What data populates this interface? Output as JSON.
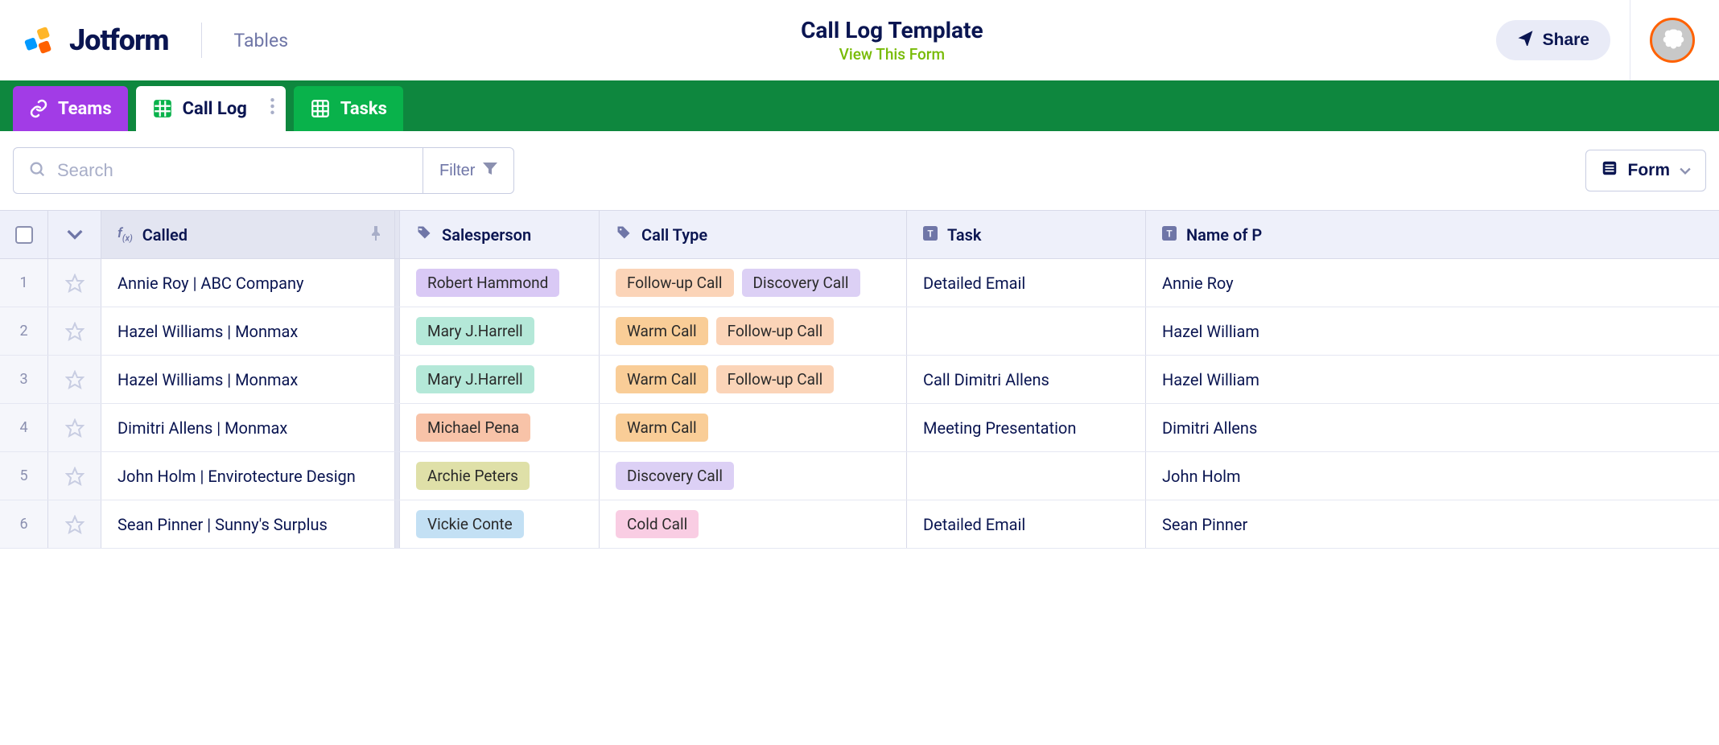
{
  "header": {
    "brand": "Jotform",
    "section": "Tables",
    "title": "Call Log Template",
    "view_form": "View This Form",
    "share": "Share"
  },
  "tabs": {
    "teams": "Teams",
    "call_log": "Call Log",
    "tasks": "Tasks"
  },
  "toolbar": {
    "search_placeholder": "Search",
    "filter": "Filter",
    "form": "Form"
  },
  "columns": {
    "called": "Called",
    "salesperson": "Salesperson",
    "call_type": "Call Type",
    "task": "Task",
    "name_of": "Name of P"
  },
  "tag_colors": {
    "Robert Hammond": "tag-purple",
    "Mary J.Harrell": "tag-teal",
    "Michael Pena": "tag-salmon",
    "Archie Peters": "tag-olive",
    "Vickie Conte": "tag-blue",
    "Follow-up Call": "tag-peach",
    "Discovery Call": "tag-lav",
    "Warm Call": "tag-orange",
    "Cold Call": "tag-pink"
  },
  "rows": [
    {
      "num": "1",
      "called": "Annie Roy | ABC Company",
      "salesperson": [
        "Robert Hammond"
      ],
      "call_type": [
        "Follow-up Call",
        "Discovery Call"
      ],
      "task": "Detailed Email",
      "name": "Annie Roy"
    },
    {
      "num": "2",
      "called": "Hazel Williams | Monmax",
      "salesperson": [
        "Mary J.Harrell"
      ],
      "call_type": [
        "Warm Call",
        "Follow-up Call"
      ],
      "task": "",
      "name": "Hazel William"
    },
    {
      "num": "3",
      "called": "Hazel Williams | Monmax",
      "salesperson": [
        "Mary J.Harrell"
      ],
      "call_type": [
        "Warm Call",
        "Follow-up Call"
      ],
      "task": "Call Dimitri Allens",
      "name": "Hazel William"
    },
    {
      "num": "4",
      "called": "Dimitri Allens | Monmax",
      "salesperson": [
        "Michael Pena"
      ],
      "call_type": [
        "Warm Call"
      ],
      "task": "Meeting Presentation",
      "name": "Dimitri Allens"
    },
    {
      "num": "5",
      "called": "John Holm | Envirotecture Design",
      "salesperson": [
        "Archie Peters"
      ],
      "call_type": [
        "Discovery Call"
      ],
      "task": "",
      "name": "John Holm"
    },
    {
      "num": "6",
      "called": "Sean Pinner | Sunny's Surplus",
      "salesperson": [
        "Vickie Conte"
      ],
      "call_type": [
        "Cold Call"
      ],
      "task": "Detailed Email",
      "name": "Sean Pinner"
    }
  ]
}
